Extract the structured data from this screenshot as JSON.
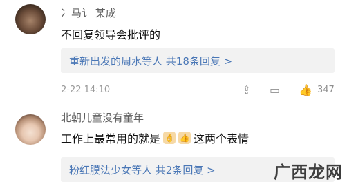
{
  "comments": [
    {
      "username": "冫马讠 某成",
      "text": "不回复领导会批评的",
      "replies_text": "重新出发的周水等人  共18条回复 >",
      "timestamp": "2-22 14:10",
      "like_count": "347"
    },
    {
      "username": "北朝儿童没有童年",
      "text_before": "工作上最常用的就是",
      "text_after": "这两个表情",
      "replies_text": "粉红膜法少女等人  共2条回复 >"
    }
  ],
  "icons": {
    "share": "share-icon",
    "comment": "comment-icon",
    "like": "thumbs-up-icon",
    "emoji1": "ok-hand-icon",
    "emoji2": "thumbs-up-emoji-icon"
  },
  "watermark": "广西龙网"
}
